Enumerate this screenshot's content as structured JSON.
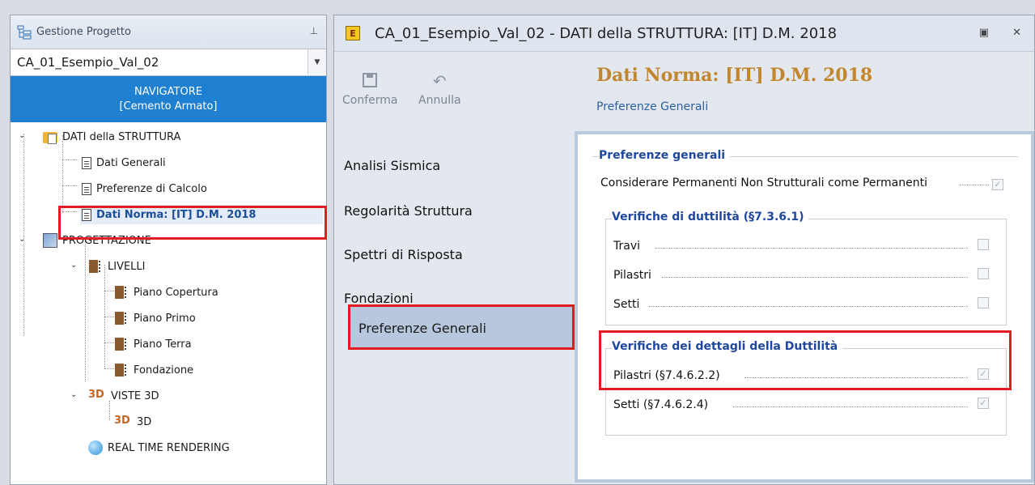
{
  "left_panel": {
    "header_title": "Gestione Progetto",
    "project": "CA_01_Esempio_Val_02",
    "navigator_line1": "NAVIGATORE",
    "navigator_line2": "[Cemento Armato]",
    "tree": {
      "dati_struttura": "DATI della STRUTTURA",
      "dati_generali": "Dati Generali",
      "preferenze_calcolo": "Preferenze di Calcolo",
      "dati_norma": "Dati Norma: [IT] D.M. 2018",
      "progettazione": "PROGETTAZIONE",
      "livelli": "LIVELLI",
      "piano_copertura": "Piano Copertura",
      "piano_primo": "Piano Primo",
      "piano_terra": "Piano Terra",
      "fondazione": "Fondazione",
      "viste_3d": "VISTE 3D",
      "vista_3d": "3D",
      "real_time": "REAL TIME RENDERING"
    }
  },
  "window": {
    "title": "CA_01_Esempio_Val_02 -  DATI della STRUTTURA: [IT] D.M. 2018",
    "app_icon_letter": "E",
    "toolbar": {
      "confirm": "Conferma",
      "cancel": "Annulla"
    },
    "page_title": "Dati Norma: [IT] D.M. 2018",
    "page_subtitle": "Preferenze Generali",
    "nav": [
      "Analisi Sismica",
      "Regolarità Struttura",
      "Spettri di Risposta",
      "Fondazioni",
      "Preferenze Generali"
    ],
    "panel": {
      "group_general": "Preferenze generali",
      "opt_permanenti": "Considerare Permanenti Non Strutturali come Permanenti",
      "opt_permanenti_checked": true,
      "group_duttilita": "Verifiche di duttilità (§7.3.6.1)",
      "travi": "Travi",
      "pilastri": "Pilastri",
      "setti": "Setti",
      "group_dettagli": "Verifiche dei dettagli della Duttilità",
      "pilastri_det": "Pilastri (§7.4.6.2.2)",
      "setti_det": "Setti (§7.4.6.2.4)"
    }
  }
}
